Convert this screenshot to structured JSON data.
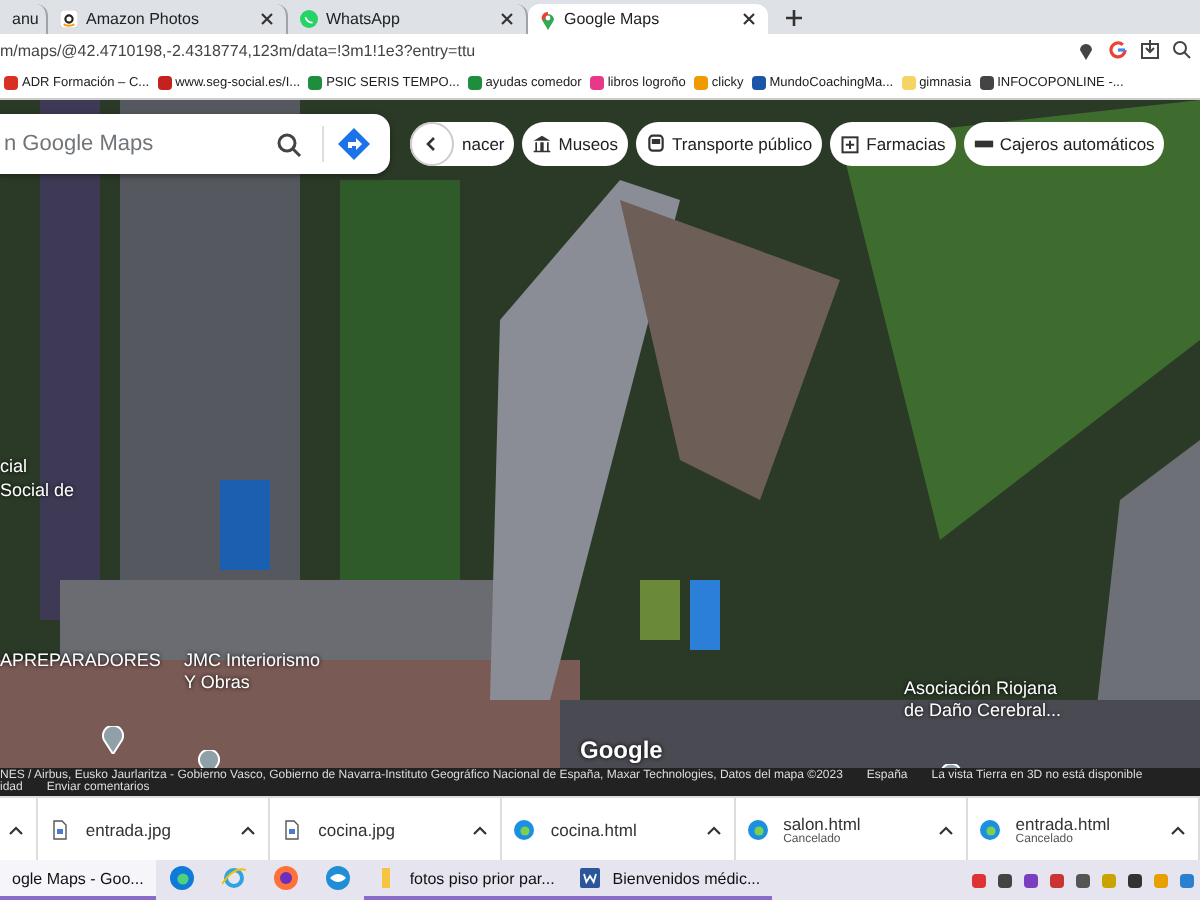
{
  "tabs": [
    {
      "title": "anu",
      "kind": "plain",
      "selected": false
    },
    {
      "title": "Amazon Photos",
      "kind": "amazon",
      "selected": false
    },
    {
      "title": "WhatsApp",
      "kind": "whatsapp",
      "selected": false
    },
    {
      "title": "Google Maps",
      "kind": "maps",
      "selected": true
    }
  ],
  "address_bar": {
    "url": "m/maps/@42.4710198,-2.4318774,123m/data=!3m1!1e3?entry=ttu"
  },
  "bookmarks": [
    {
      "label": "ADR Formación – C...",
      "color": "#d93025"
    },
    {
      "label": "www.seg-social.es/I...",
      "color": "#c5221f"
    },
    {
      "label": "PSIC SERIS TEMPO...",
      "color": "#1e8e3e"
    },
    {
      "label": "ayudas comedor",
      "color": "#1e8e3e"
    },
    {
      "label": "libros logroño",
      "color": "#e8388a"
    },
    {
      "label": "clicky",
      "color": "#f29900"
    },
    {
      "label": "MundoCoachingMa...",
      "color": "#1a56a8"
    },
    {
      "label": "gimnasia",
      "color": "#f6d365"
    },
    {
      "label": "INFOCOPONLINE -...",
      "color": "#444444"
    }
  ],
  "map": {
    "search": {
      "placeholder": "n Google Maps"
    },
    "chips": [
      {
        "label": "nacer",
        "kind": "back"
      },
      {
        "label": "Museos",
        "kind": "museum"
      },
      {
        "label": "Transporte público",
        "kind": "transit"
      },
      {
        "label": "Farmacias",
        "kind": "pharmacy"
      },
      {
        "label": "Cajeros automáticos",
        "kind": "atm"
      }
    ],
    "labels": [
      {
        "text": "cial"
      },
      {
        "text": "Social de"
      },
      {
        "text": "APREPARADORES"
      },
      {
        "text": "JMC Interiorismo"
      },
      {
        "text": "Y Obras"
      },
      {
        "text": "Asociación Riojana"
      },
      {
        "text": "de Daño Cerebral..."
      }
    ],
    "logo": "Google",
    "attribution": {
      "credits": "NES / Airbus, Eusko Jaurlaritza - Gobierno Vasco, Gobierno de Navarra-Instituto Geográfico Nacional de España, Maxar Technologies, Datos del mapa ©2023",
      "country": "España",
      "notice": "La vista Tierra en 3D no está disponible",
      "privacy": "idad",
      "feedback": "Enviar comentarios"
    }
  },
  "downloads": [
    {
      "kind": "none"
    },
    {
      "kind": "image",
      "filename": "entrada.jpg"
    },
    {
      "kind": "image",
      "filename": "cocina.jpg"
    },
    {
      "kind": "html",
      "filename": "cocina.html"
    },
    {
      "kind": "html",
      "filename": "salon.html",
      "status": "Cancelado"
    },
    {
      "kind": "html",
      "filename": "entrada.html",
      "status": "Cancelado"
    }
  ],
  "taskbar": [
    {
      "kind": "chrome",
      "label": "ogle Maps - Goo...",
      "selected": true
    },
    {
      "kind": "edge"
    },
    {
      "kind": "ie"
    },
    {
      "kind": "firefox"
    },
    {
      "kind": "blue"
    },
    {
      "kind": "folder",
      "label": "fotos piso prior par...",
      "selected": false
    },
    {
      "kind": "word",
      "label": "Bienvenidos médic...",
      "selected": false
    }
  ]
}
